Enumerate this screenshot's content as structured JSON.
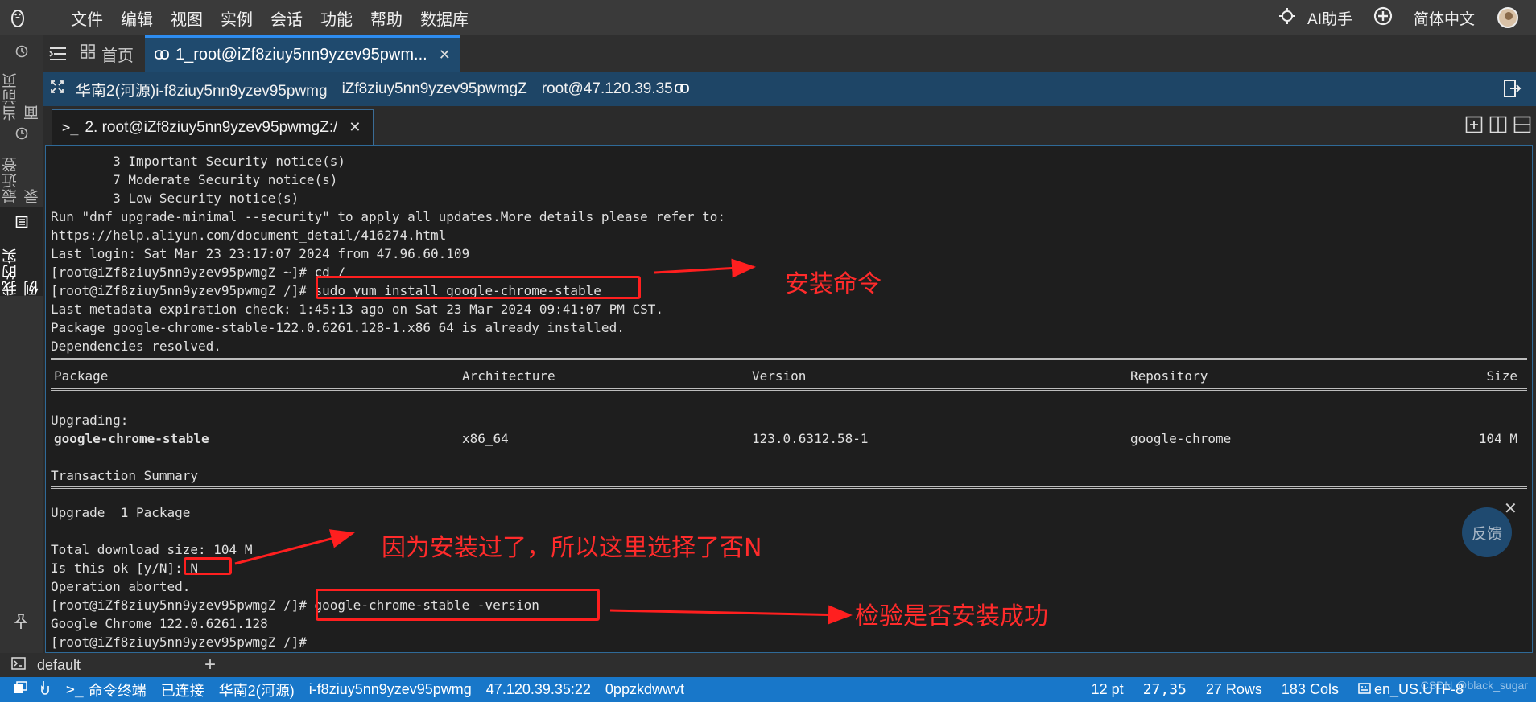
{
  "menu": {
    "items": [
      "文件",
      "编辑",
      "视图",
      "实例",
      "会话",
      "功能",
      "帮助",
      "数据库"
    ],
    "ai_label": "AI助手",
    "language": "简体中文"
  },
  "sidebar": {
    "items": [
      {
        "label": "当前页面",
        "icon": "clock-icon"
      },
      {
        "label": "最近登录",
        "icon": "history-icon"
      },
      {
        "label": "我的实例",
        "icon": "list-icon"
      }
    ]
  },
  "tabs": {
    "home_label": "首页",
    "active_label": "1_root@iZf8ziuy5nn9yzev95pwm..."
  },
  "connection": {
    "region": "华南2(河源)i-f8ziuy5nn9yzev95pwmg",
    "hostname": "iZf8ziuy5nn9yzev95pwmgZ",
    "user_ip": "root@47.120.39.35"
  },
  "terminal_tab": {
    "label": "2. root@iZf8ziuy5nn9yzev95pwmgZ:/"
  },
  "terminal": {
    "lines_top": [
      "        3 Important Security notice(s)",
      "        7 Moderate Security notice(s)",
      "        3 Low Security notice(s)",
      "Run \"dnf upgrade-minimal --security\" to apply all updates.More details please refer to:",
      "https://help.aliyun.com/document_detail/416274.html",
      "Last login: Sat Mar 23 23:17:07 2024 from 47.96.60.109",
      "[root@iZf8ziuy5nn9yzev95pwmgZ ~]# cd /",
      "[root@iZf8ziuy5nn9yzev95pwmgZ /]# sudo yum install google-chrome-stable",
      "Last metadata expiration check: 1:45:13 ago on Sat 23 Mar 2024 09:41:07 PM CST.",
      "Package google-chrome-stable-122.0.6261.128-1.x86_64 is already installed.",
      "Dependencies resolved."
    ],
    "table_headers": [
      "Package",
      "Architecture",
      "Version",
      "Repository",
      "Size"
    ],
    "upgrading_label": "Upgrading:",
    "package_row": [
      "google-chrome-stable",
      "x86_64",
      "123.0.6312.58-1",
      "google-chrome",
      "104 M"
    ],
    "transaction_summary": "Transaction Summary",
    "upgrade_line": "Upgrade  1 Package",
    "lines_bottom": [
      "Total download size: 104 M",
      "Is this ok [y/N]: N",
      "Operation aborted.",
      "[root@iZf8ziuy5nn9yzev95pwmgZ /]# google-chrome-stable -version",
      "Google Chrome 122.0.6261.128",
      "[root@iZf8ziuy5nn9yzev95pwmgZ /]#"
    ]
  },
  "annotations": {
    "install_cmd": "安装命令",
    "choose_no": "因为安装过了，所以这里选择了否N",
    "verify": "检验是否安装成功"
  },
  "feedback_label": "反馈",
  "session": {
    "name": "default"
  },
  "statusbar": {
    "terminal": "命令终端",
    "state": "已连接",
    "region": "华南2(河源)",
    "instance": "i-f8ziuy5nn9yzev95pwmg",
    "address": "47.120.39.35:22",
    "session_id": "0ppzkdwwvt",
    "font_size": "12 pt",
    "cursor": "27,35",
    "rows": "27 Rows",
    "cols": "183 Cols",
    "encoding": "en_US.UTF-8",
    "watermark": "CSDN @black_sugar"
  },
  "colors": {
    "accent_blue": "#1877c9",
    "annotation_red": "#ff1f1f",
    "package_green": "#a6e22e"
  }
}
